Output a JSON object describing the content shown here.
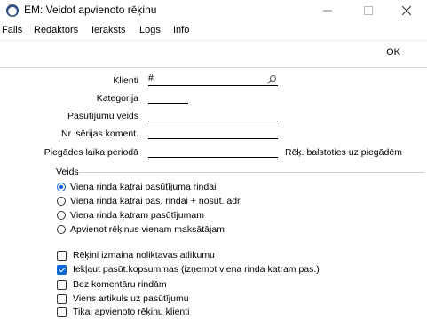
{
  "window": {
    "icon": "em-logo-icon",
    "title": "EM: Veidot apvienoto rēķinu"
  },
  "menu": [
    "Fails",
    "Redaktors",
    "Ieraksts",
    "Logs",
    "Info"
  ],
  "toolbar": {
    "ok_label": "OK"
  },
  "form": {
    "klienti_label": "Klienti",
    "klienti_value": "#",
    "kategorija_label": "Kategorija",
    "kategorija_value": "",
    "pasutijumu_veids_label": "Pasūtījumu veids",
    "pasutijumu_veids_value": "",
    "nr_serijas_label": "Nr. sērijas koment.",
    "nr_serijas_value": "",
    "piegades_label": "Piegādes laika periodā",
    "piegades_value": "",
    "piegades_right_label": "Rēķ. balstoties uz piegādēm"
  },
  "veids": {
    "title": "Veids",
    "options": [
      {
        "label": "Viena rinda katrai pasūtījuma rindai",
        "selected": true
      },
      {
        "label": "Viena rinda katrai pas. rindai + nosūt. adr.",
        "selected": false
      },
      {
        "label": "Viena rinda katram pasūtījumam",
        "selected": false
      },
      {
        "label": "Apvienot rēķinus vienam maksātājam",
        "selected": false
      }
    ]
  },
  "checks": [
    {
      "label": "Rēķini izmaina noliktavas atlikumu",
      "checked": false
    },
    {
      "label": "Iekļaut pasūt.kopsummas (izņemot viena rinda katram pas.)",
      "checked": true
    },
    {
      "label": "Bez komentāru rindām",
      "checked": false
    },
    {
      "label": "Viens artikuls uz pasūtījumu",
      "checked": false
    },
    {
      "label": "Tikai apvienoto rēķinu klienti",
      "checked": false
    }
  ],
  "colors": {
    "accent": "#0a64d2"
  }
}
